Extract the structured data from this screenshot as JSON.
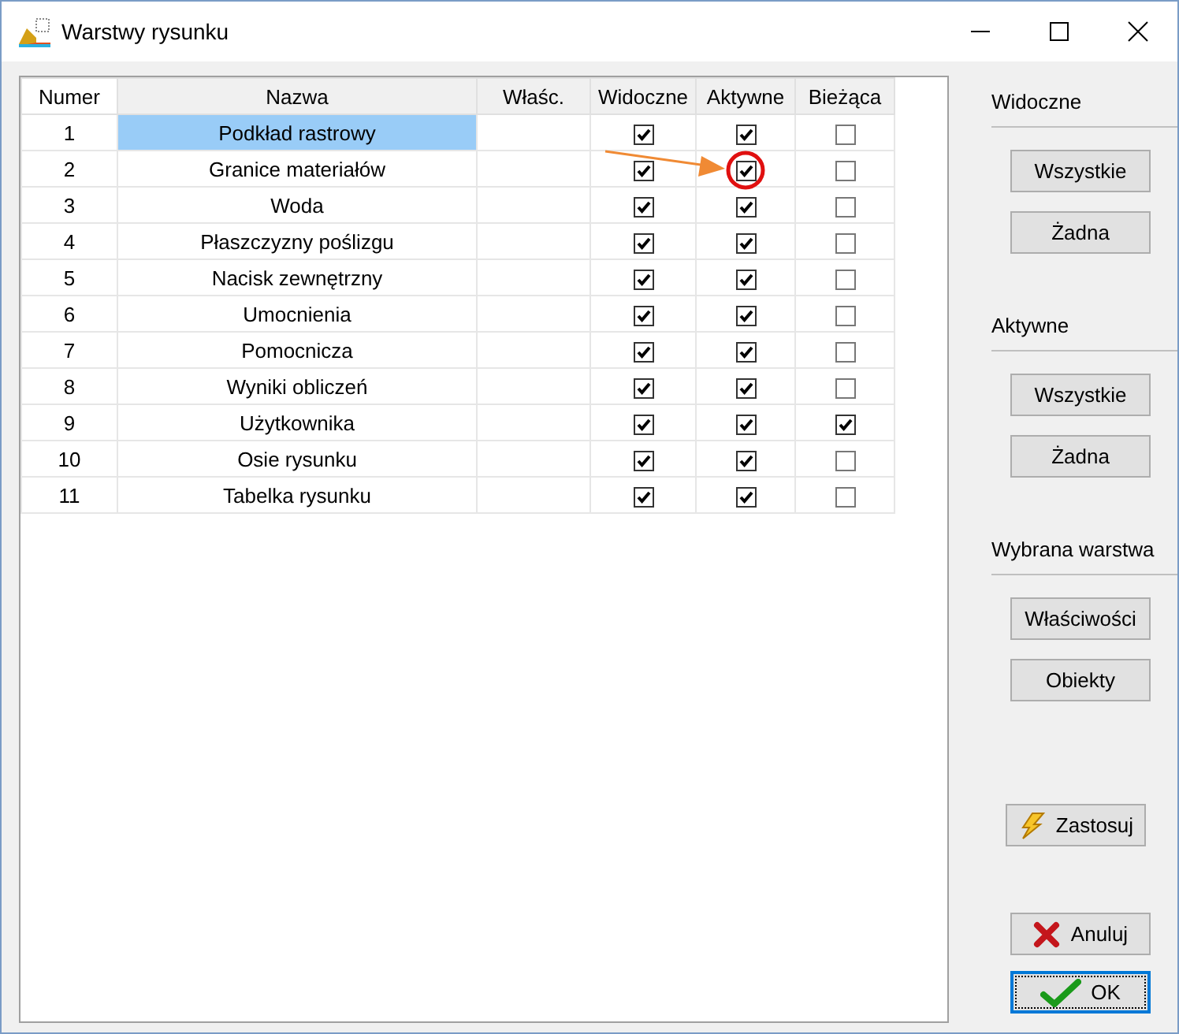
{
  "window": {
    "title": "Warstwy rysunku"
  },
  "table": {
    "columns": [
      "Numer",
      "Nazwa",
      "Właśc.",
      "Widoczne",
      "Aktywne",
      "Bieżąca"
    ],
    "rows": [
      {
        "number": "1",
        "name": "Podkład rastrowy",
        "selected": true,
        "visible": true,
        "active": true,
        "current": false
      },
      {
        "number": "2",
        "name": "Granice materiałów",
        "selected": false,
        "visible": true,
        "active": true,
        "current": false
      },
      {
        "number": "3",
        "name": "Woda",
        "selected": false,
        "visible": true,
        "active": true,
        "current": false
      },
      {
        "number": "4",
        "name": "Płaszczyzny poślizgu",
        "selected": false,
        "visible": true,
        "active": true,
        "current": false
      },
      {
        "number": "5",
        "name": "Nacisk zewnętrzny",
        "selected": false,
        "visible": true,
        "active": true,
        "current": false
      },
      {
        "number": "6",
        "name": "Umocnienia",
        "selected": false,
        "visible": true,
        "active": true,
        "current": false
      },
      {
        "number": "7",
        "name": "Pomocnicza",
        "selected": false,
        "visible": true,
        "active": true,
        "current": false
      },
      {
        "number": "8",
        "name": "Wyniki obliczeń",
        "selected": false,
        "visible": true,
        "active": true,
        "current": false
      },
      {
        "number": "9",
        "name": "Użytkownika",
        "selected": false,
        "visible": true,
        "active": true,
        "current": true
      },
      {
        "number": "10",
        "name": "Osie rysunku",
        "selected": false,
        "visible": true,
        "active": true,
        "current": false
      },
      {
        "number": "11",
        "name": "Tabelka rysunku",
        "selected": false,
        "visible": true,
        "active": true,
        "current": false
      }
    ]
  },
  "annotations": [
    {
      "kind": "arrow"
    },
    {
      "kind": "circle"
    }
  ],
  "side_panel": {
    "groups": [
      {
        "label": "Widoczne",
        "buttons": [
          "Wszystkie",
          "Żadna"
        ]
      },
      {
        "label": "Aktywne",
        "buttons": [
          "Wszystkie",
          "Żadna"
        ]
      },
      {
        "label": "Wybrana warstwa",
        "buttons": [
          "Właściwości",
          "Obiekty"
        ]
      }
    ],
    "actions": [
      {
        "kind": "apply",
        "label": "Zastosuj",
        "default": false
      },
      {
        "kind": "cancel",
        "label": "Anuluj",
        "default": false
      },
      {
        "kind": "ok",
        "label": "OK",
        "default": true
      }
    ]
  }
}
